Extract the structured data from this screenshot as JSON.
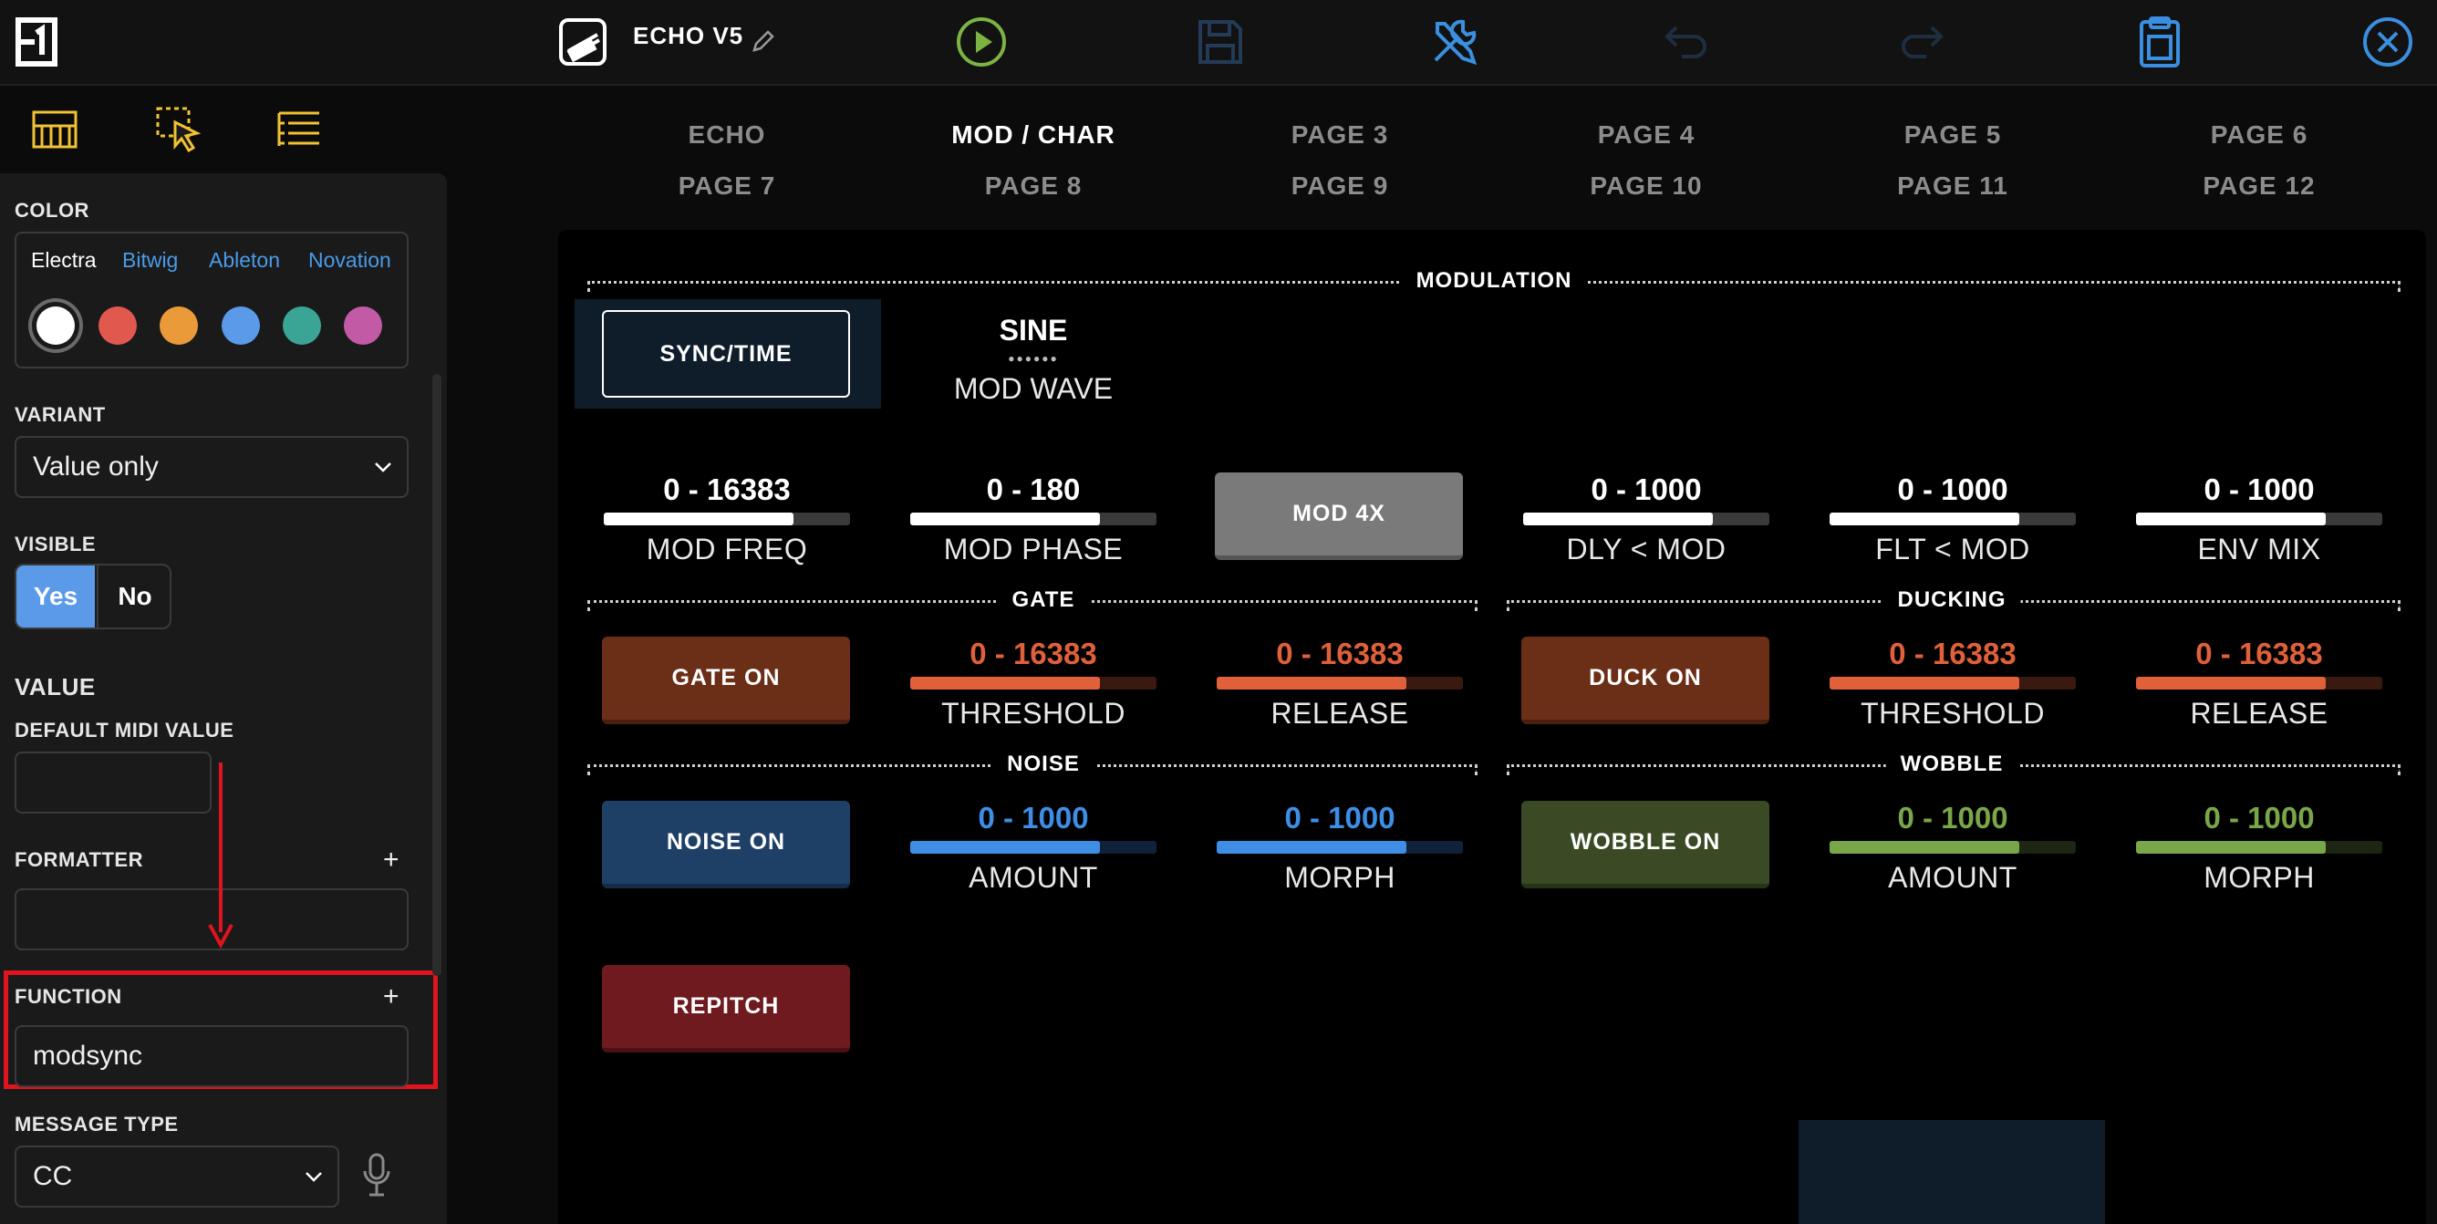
{
  "topbar": {
    "logo": "electra-logo-icon",
    "preset_name": "ECHO V5",
    "icons": [
      "preset-icon",
      "pencil-icon",
      "play-icon",
      "save-icon",
      "tools-icon",
      "undo-icon",
      "redo-icon",
      "clipboard-icon",
      "close-icon"
    ]
  },
  "sidebar": {
    "tabs": [
      "keyboard-icon",
      "select-cursor-icon",
      "list-icon"
    ],
    "color": {
      "label": "COLOR",
      "palettes": [
        "Electra",
        "Bitwig",
        "Ableton",
        "Novation"
      ],
      "active_palette": "Electra",
      "swatches": [
        "#ffffff",
        "#e0584e",
        "#eb9a3a",
        "#5a9ae8",
        "#3aa594",
        "#c25aa6"
      ],
      "selected_swatch": "#ffffff"
    },
    "variant": {
      "label": "VARIANT",
      "value": "Value only"
    },
    "visible": {
      "label": "VISIBLE",
      "yes": "Yes",
      "no": "No",
      "selected": "Yes"
    },
    "value_section": "VALUE",
    "default_midi": {
      "label": "DEFAULT MIDI VALUE",
      "value": ""
    },
    "formatter": {
      "label": "FORMATTER",
      "plus": "+",
      "value": ""
    },
    "function": {
      "label": "FUNCTION",
      "plus": "+",
      "value": "modsync"
    },
    "message_type": {
      "label": "MESSAGE TYPE",
      "value": "CC"
    }
  },
  "pages": {
    "active": "MOD / CHAR",
    "row1": [
      "ECHO",
      "MOD / CHAR",
      "PAGE 3",
      "PAGE 4",
      "PAGE 5",
      "PAGE 6"
    ],
    "row2": [
      "PAGE 7",
      "PAGE 8",
      "PAGE 9",
      "PAGE 10",
      "PAGE 11",
      "PAGE 12"
    ]
  },
  "panel": {
    "groups": {
      "modulation": "MODULATION",
      "gate": "GATE",
      "ducking": "DUCKING",
      "noise": "NOISE",
      "wobble": "WOBBLE"
    },
    "sync_time": "SYNC/TIME",
    "mod_wave": {
      "value": "SINE",
      "label": "MOD WAVE",
      "dots": "●●●●●●"
    },
    "mod_4x": "MOD 4X",
    "faders_row1": [
      {
        "range": "0 - 16383",
        "label": "MOD FREQ",
        "level": 0.77
      },
      {
        "range": "0 - 180",
        "label": "MOD PHASE",
        "level": 0.77
      },
      {
        "range": "0 - 1000",
        "label": "DLY < MOD",
        "level": 0.77
      },
      {
        "range": "0 - 1000",
        "label": "FLT < MOD",
        "level": 0.77
      },
      {
        "range": "0 - 1000",
        "label": "ENV MIX",
        "level": 0.77
      }
    ],
    "gate_on": "GATE ON",
    "gate_faders": [
      {
        "range": "0 - 16383",
        "label": "THRESHOLD",
        "level": 0.77
      },
      {
        "range": "0 - 16383",
        "label": "RELEASE",
        "level": 0.77
      }
    ],
    "duck_on": "DUCK ON",
    "duck_faders": [
      {
        "range": "0 - 16383",
        "label": "THRESHOLD",
        "level": 0.77
      },
      {
        "range": "0 - 16383",
        "label": "RELEASE",
        "level": 0.77
      }
    ],
    "noise_on": "NOISE ON",
    "noise_faders": [
      {
        "range": "0 - 1000",
        "label": "AMOUNT",
        "level": 0.77
      },
      {
        "range": "0 - 1000",
        "label": "MORPH",
        "level": 0.77
      }
    ],
    "wobble_on": "WOBBLE ON",
    "wobble_faders": [
      {
        "range": "0 - 1000",
        "label": "AMOUNT",
        "level": 0.77
      },
      {
        "range": "0 - 1000",
        "label": "MORPH",
        "level": 0.77
      }
    ],
    "repitch": "REPITCH"
  },
  "colors": {
    "accent_yellow": "#f1c232",
    "accent_blue": "#3a8fe0",
    "play_green": "#7cb342",
    "highlight_red": "#e0141e",
    "gate_orange": "#e0603a",
    "noise_blue": "#3e8ee6",
    "wobble_green": "#7aa64a"
  }
}
